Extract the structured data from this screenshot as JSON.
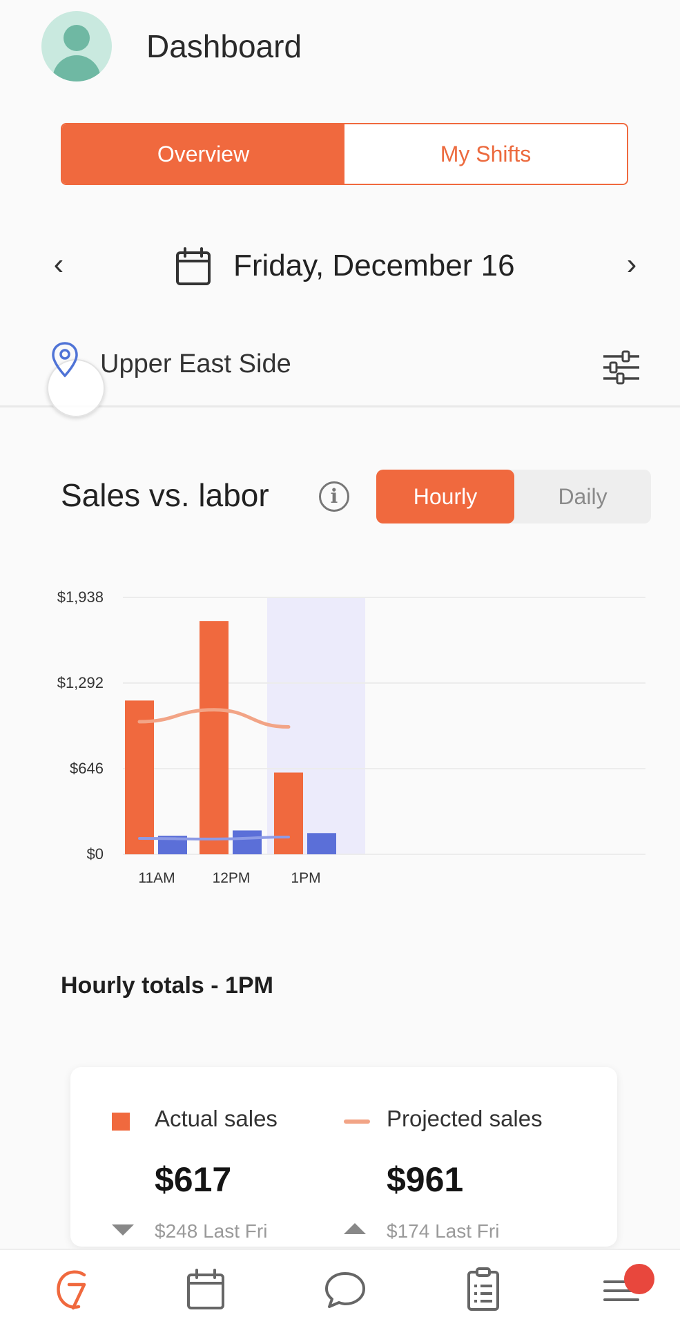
{
  "header": {
    "title": "Dashboard",
    "avatar_icon": "user-avatar-icon"
  },
  "tabs": {
    "overview": "Overview",
    "my_shifts": "My Shifts",
    "active": "Overview"
  },
  "date_nav": {
    "prev_icon": "‹",
    "next_icon": "›",
    "date": "Friday, December 16"
  },
  "location": {
    "name": "Upper East Side"
  },
  "chart_section": {
    "title": "Sales vs. labor",
    "toggle": {
      "hourly": "Hourly",
      "daily": "Daily",
      "active": "Hourly"
    }
  },
  "chart_data": {
    "type": "bar",
    "categories": [
      "11AM",
      "12PM",
      "1PM"
    ],
    "series": [
      {
        "name": "Actual sales",
        "type": "bar",
        "color": "#f0693e",
        "values": [
          1160,
          1760,
          617
        ]
      },
      {
        "name": "Labor",
        "type": "bar",
        "color": "#5b6fd8",
        "values": [
          140,
          180,
          160
        ]
      },
      {
        "name": "Projected sales",
        "type": "line",
        "color": "#f2a486",
        "values": [
          1000,
          1090,
          961
        ]
      },
      {
        "type": "line",
        "color": "#8d9be6",
        "values": [
          120,
          115,
          130
        ]
      }
    ],
    "ylim": [
      0,
      1938
    ],
    "yticks": [
      "$0",
      "$646",
      "$1,292",
      "$1,938"
    ],
    "ytick_values": [
      0,
      646,
      1292,
      1938
    ],
    "highlighted_category": "1PM",
    "highlight_color": "#ecebfb",
    "grid": true
  },
  "totals": {
    "title": "Hourly totals - 1PM",
    "actual": {
      "label": "Actual sales",
      "value": "$617",
      "compare": "$248 Last Fri",
      "trend": "down"
    },
    "projected": {
      "label": "Projected sales",
      "value": "$961",
      "compare": "$174 Last Fri",
      "trend": "up"
    }
  },
  "bottom_nav": {
    "items": [
      "home-logo-icon",
      "calendar-icon",
      "chat-icon",
      "clipboard-icon",
      "menu-icon"
    ],
    "accent": "#f0693e",
    "notification_color": "#e8473d"
  }
}
